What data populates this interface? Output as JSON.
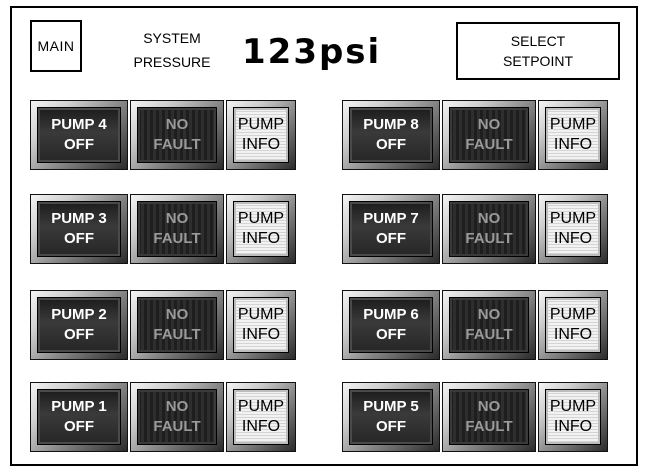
{
  "header": {
    "main_label": "MAIN",
    "system_label_line1": "SYSTEM",
    "system_label_line2": "PRESSURE",
    "pressure_value": "123psi",
    "setpoint_line1": "SELECT",
    "setpoint_line2": "SETPOINT"
  },
  "pumps": {
    "p4": {
      "name": "PUMP 4",
      "state": "OFF",
      "fault1": "NO",
      "fault2": "FAULT",
      "info1": "PUMP",
      "info2": "INFO"
    },
    "p8": {
      "name": "PUMP 8",
      "state": "OFF",
      "fault1": "NO",
      "fault2": "FAULT",
      "info1": "PUMP",
      "info2": "INFO"
    },
    "p3": {
      "name": "PUMP 3",
      "state": "OFF",
      "fault1": "NO",
      "fault2": "FAULT",
      "info1": "PUMP",
      "info2": "INFO"
    },
    "p7": {
      "name": "PUMP 7",
      "state": "OFF",
      "fault1": "NO",
      "fault2": "FAULT",
      "info1": "PUMP",
      "info2": "INFO"
    },
    "p2": {
      "name": "PUMP 2",
      "state": "OFF",
      "fault1": "NO",
      "fault2": "FAULT",
      "info1": "PUMP",
      "info2": "INFO"
    },
    "p6": {
      "name": "PUMP 6",
      "state": "OFF",
      "fault1": "NO",
      "fault2": "FAULT",
      "info1": "PUMP",
      "info2": "INFO"
    },
    "p1": {
      "name": "PUMP 1",
      "state": "OFF",
      "fault1": "NO",
      "fault2": "FAULT",
      "info1": "PUMP",
      "info2": "INFO"
    },
    "p5": {
      "name": "PUMP 5",
      "state": "OFF",
      "fault1": "NO",
      "fault2": "FAULT",
      "info1": "PUMP",
      "info2": "INFO"
    }
  }
}
